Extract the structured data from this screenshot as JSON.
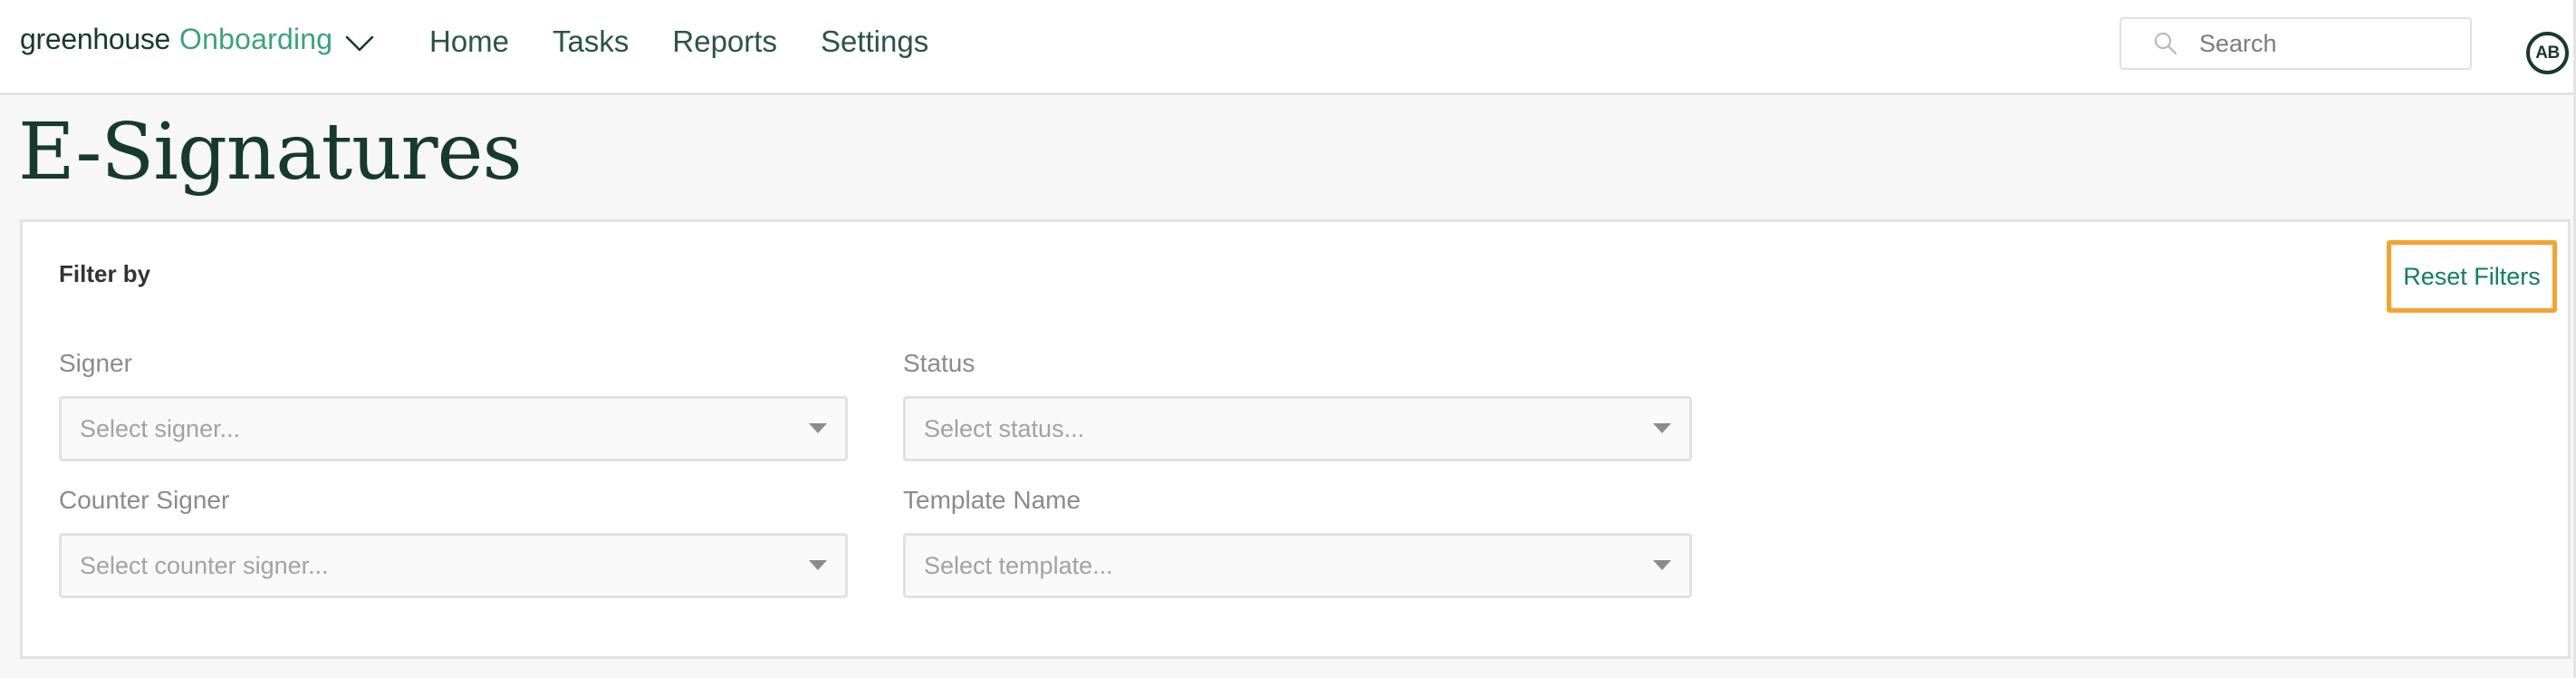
{
  "header": {
    "brand": {
      "company": "greenhouse",
      "product": "Onboarding",
      "menu_icon": "chevron-down-icon"
    },
    "nav": [
      {
        "label": "Home"
      },
      {
        "label": "Tasks"
      },
      {
        "label": "Reports"
      },
      {
        "label": "Settings"
      }
    ],
    "search": {
      "placeholder": "Search",
      "value": "",
      "icon": "search-icon"
    },
    "avatar": {
      "initials": "AB"
    }
  },
  "page": {
    "title": "E-Signatures"
  },
  "filters": {
    "heading": "Filter by",
    "reset_label": "Reset Filters",
    "fields": [
      {
        "label": "Signer",
        "placeholder": "Select signer...",
        "value": ""
      },
      {
        "label": "Status",
        "placeholder": "Select status...",
        "value": ""
      },
      {
        "label": "Counter Signer",
        "placeholder": "Select counter signer...",
        "value": ""
      },
      {
        "label": "Template Name",
        "placeholder": "Select template...",
        "value": ""
      }
    ]
  },
  "colors": {
    "brand_dark": "#173a2e",
    "brand_green": "#3aa37c",
    "link_green": "#0f7e5d",
    "highlight_orange": "#f5a32e",
    "page_background": "#f7f7f7"
  }
}
